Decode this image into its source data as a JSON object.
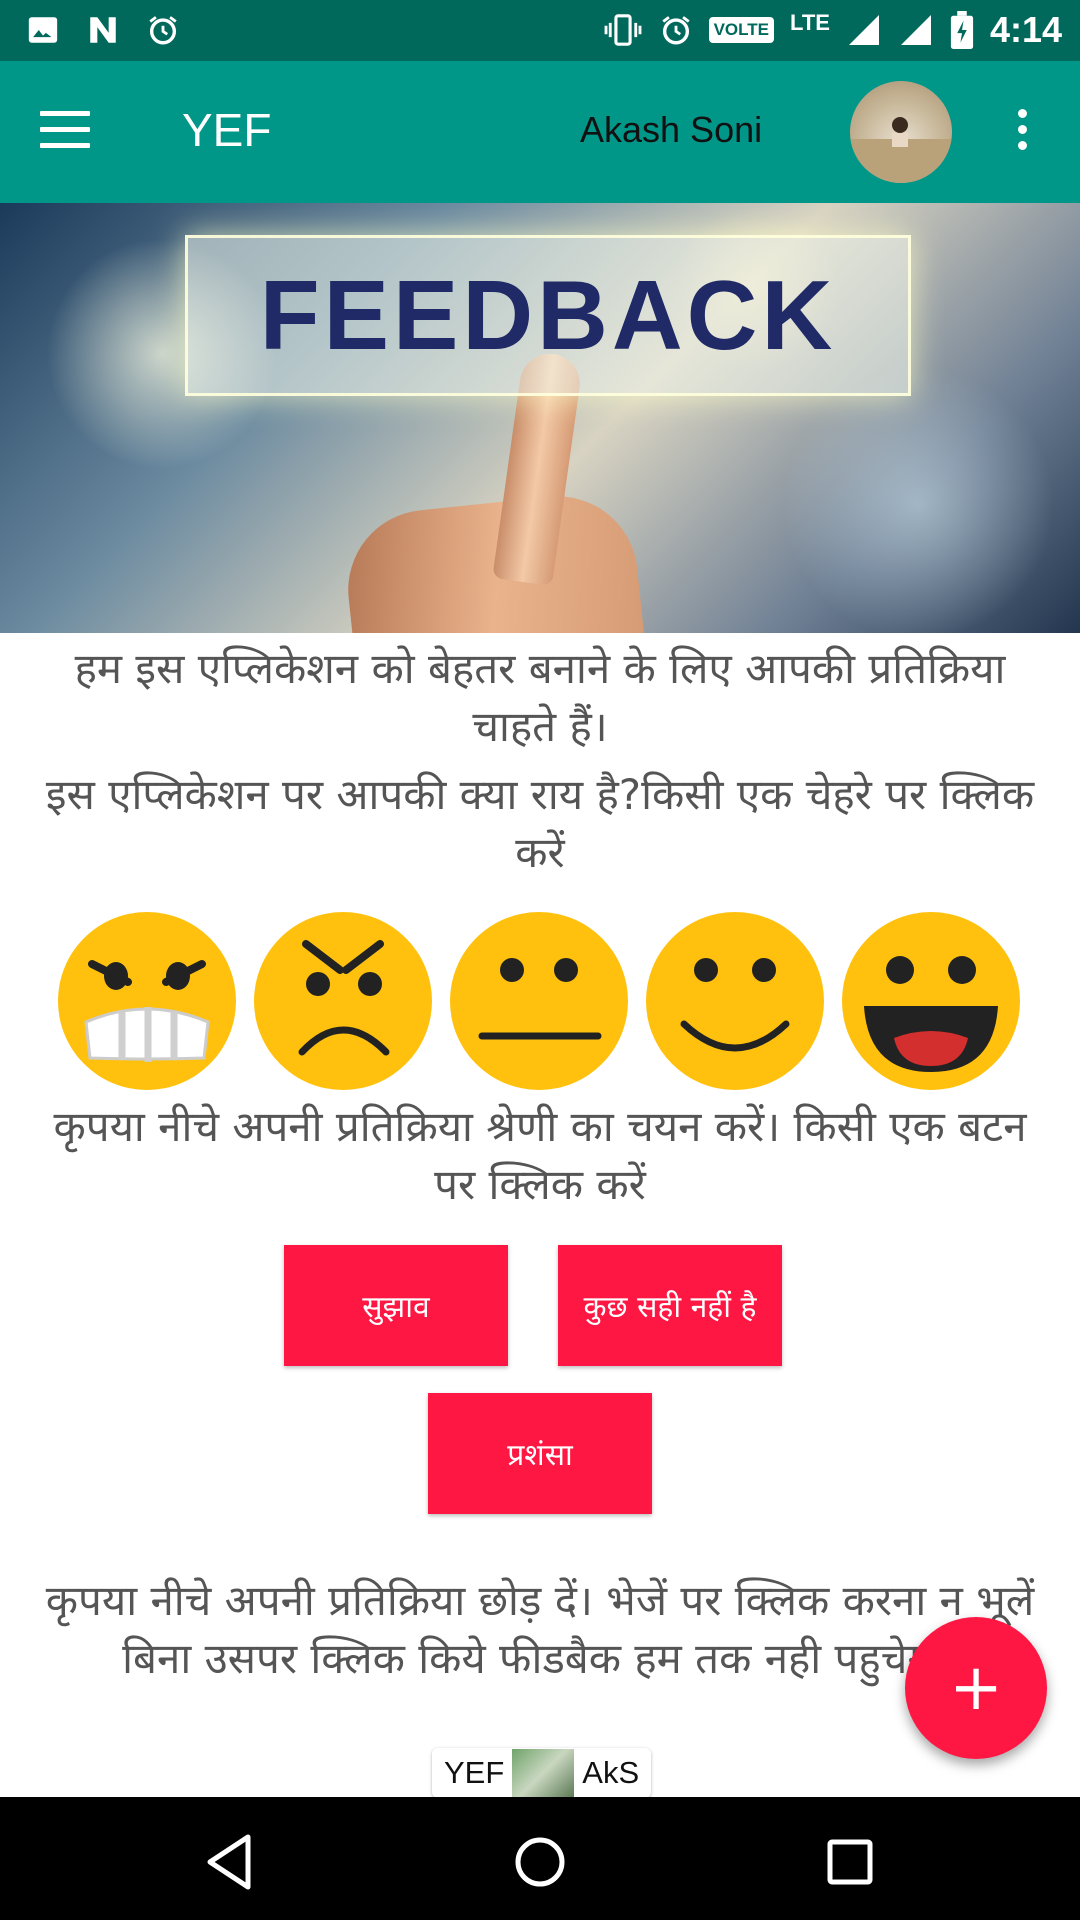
{
  "status_bar": {
    "time": "4:14",
    "volte": "VOLTE",
    "network": "LTE",
    "icons": [
      "image-icon",
      "n-icon",
      "alarm-icon",
      "vibrate-icon",
      "alarm-icon",
      "signal-icon",
      "signal-icon",
      "battery-charging-icon"
    ]
  },
  "app_bar": {
    "title": "YEF",
    "user_name": "Akash Soni"
  },
  "banner": {
    "text": "FEEDBACK"
  },
  "intro_text": "हम इस एप्लिकेशन को बेहतर बनाने के लिए आपकी प्रतिक्रिया चाहते हैं।",
  "question_text": "इस एप्लिकेशन पर आपकी क्या राय है?किसी एक चेहरे पर क्लिक करें",
  "emojis": [
    "angry-face-icon",
    "frowning-face-icon",
    "neutral-face-icon",
    "smiling-face-icon",
    "grinning-face-icon"
  ],
  "category_text": "कृपया नीचे अपनी प्रतिक्रिया श्रेणी का चयन करें। किसी एक बटन पर क्लिक करें",
  "category_buttons": {
    "suggestion": "सुझाव",
    "something_wrong": "कुछ सही नहीं है",
    "praise": "प्रशंसा"
  },
  "leave_feedback_text": "कृपया नीचे अपनी प्रतिक्रिया छोड़ दें। भेजें पर क्लिक करना न भूलें  बिना उसपर क्लिक किये फीडबैक हम तक नही पहुचेगा।",
  "fab_label": "+",
  "toast": {
    "left": "YEF",
    "right": "AkS"
  },
  "colors": {
    "status_bar": "#00695c",
    "app_bar": "#009688",
    "accent": "#ff1744",
    "emoji": "#ffc10e"
  }
}
